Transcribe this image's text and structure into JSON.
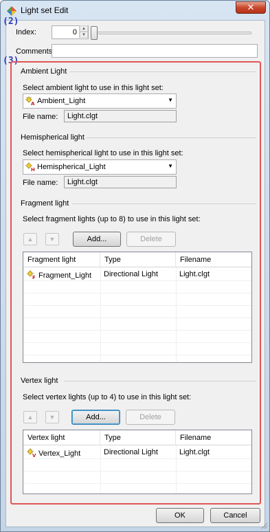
{
  "window": {
    "title": "Light set Edit",
    "close_label": "✕"
  },
  "annotations": {
    "a2": "(2)",
    "a3": "(3)"
  },
  "index": {
    "label": "Index:",
    "value": "0"
  },
  "comments": {
    "label": "Comments",
    "value": ""
  },
  "ambient": {
    "title": "Ambient Light",
    "prompt": "Select ambient light to use in this light set:",
    "selected": "Ambient_Light",
    "file_label": "File name:",
    "file_value": "Light.clgt"
  },
  "hemispherical": {
    "title": "Hemispherical light",
    "prompt": "Select hemispherical light to use in this light set:",
    "selected": "Hemispherical_Light",
    "file_label": "File name:",
    "file_value": "Light.clgt"
  },
  "fragment": {
    "title": "Fragment light",
    "prompt": "Select fragment lights (up to 8) to use in this light set:",
    "add_label": "Add...",
    "delete_label": "Delete",
    "columns": [
      "Fragment light",
      "Type",
      "Filename"
    ],
    "rows": [
      {
        "name": "Fragment_Light",
        "type": "Directional Light",
        "file": "Light.clgt"
      }
    ]
  },
  "vertex": {
    "title": "Vertex light",
    "prompt": "Select vertex lights (up to 4) to use in this light set:",
    "add_label": "Add...",
    "delete_label": "Delete",
    "columns": [
      "Vertex light",
      "Type",
      "Filename"
    ],
    "rows": [
      {
        "name": "Vertex_Light",
        "type": "Directional Light",
        "file": "Light.clgt"
      }
    ]
  },
  "footer": {
    "ok_label": "OK",
    "cancel_label": "Cancel"
  },
  "colors": {
    "annotation": "#2a3fc0",
    "highlight_box": "#e05555"
  }
}
